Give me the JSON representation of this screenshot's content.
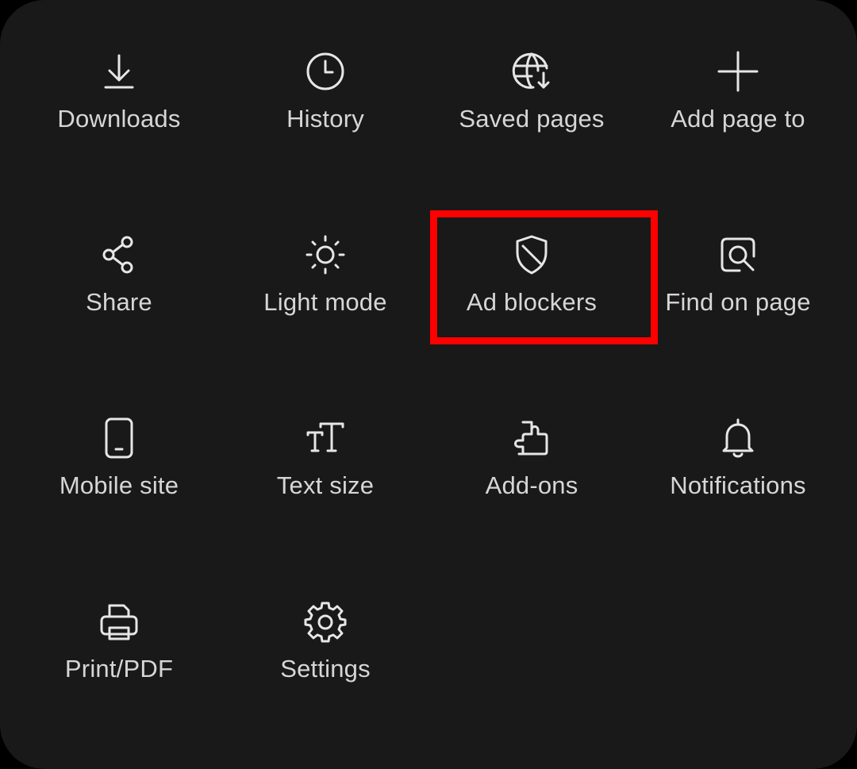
{
  "menu": {
    "items": [
      {
        "label": "Downloads",
        "icon": "download-icon"
      },
      {
        "label": "History",
        "icon": "clock-icon"
      },
      {
        "label": "Saved pages",
        "icon": "globe-download-icon"
      },
      {
        "label": "Add page to",
        "icon": "plus-icon"
      },
      {
        "label": "Share",
        "icon": "share-icon"
      },
      {
        "label": "Light mode",
        "icon": "sun-icon"
      },
      {
        "label": "Ad blockers",
        "icon": "shield-icon"
      },
      {
        "label": "Find on page",
        "icon": "search-page-icon"
      },
      {
        "label": "Mobile site",
        "icon": "phone-icon"
      },
      {
        "label": "Text size",
        "icon": "text-size-icon"
      },
      {
        "label": "Add-ons",
        "icon": "puzzle-icon"
      },
      {
        "label": "Notifications",
        "icon": "bell-icon"
      },
      {
        "label": "Print/PDF",
        "icon": "printer-icon"
      },
      {
        "label": "Settings",
        "icon": "gear-icon"
      }
    ]
  },
  "colors": {
    "background": "#191919",
    "text": "#d6d6d6",
    "icon": "#e6e6e6",
    "highlight": "#ff0000"
  }
}
